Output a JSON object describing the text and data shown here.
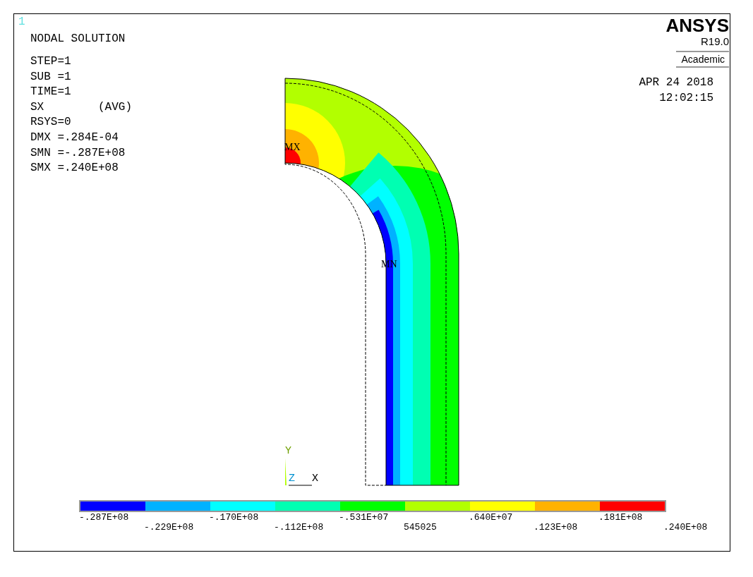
{
  "window_number": "1",
  "title": "NODAL SOLUTION",
  "info_lines": [
    "STEP=1",
    "SUB =1",
    "TIME=1",
    "SX        (AVG)",
    "RSYS=0",
    "DMX =.284E-04",
    "SMN =-.287E+08",
    "SMX =.240E+08"
  ],
  "logo": {
    "brand": "ANSYS",
    "version": "R19.0",
    "license": "Academic"
  },
  "date": "APR 24 2018",
  "time": "12:02:15",
  "plot": {
    "max_label": "MX",
    "min_label": "MN",
    "axes": {
      "y": "Y",
      "z": "Z",
      "x": "X"
    }
  },
  "legend": {
    "bands": [
      {
        "color": "#0000ff"
      },
      {
        "color": "#00b2ff"
      },
      {
        "color": "#00ffff"
      },
      {
        "color": "#00ffb2"
      },
      {
        "color": "#00ff00"
      },
      {
        "color": "#b2ff00"
      },
      {
        "color": "#ffff00"
      },
      {
        "color": "#ffb200"
      },
      {
        "color": "#ff0000"
      }
    ],
    "labels": [
      "-.287E+08",
      "-.229E+08",
      "-.170E+08",
      "-.112E+08",
      "-.531E+07",
      "545025",
      ".640E+07",
      ".123E+08",
      ".181E+08",
      ".240E+08"
    ]
  }
}
